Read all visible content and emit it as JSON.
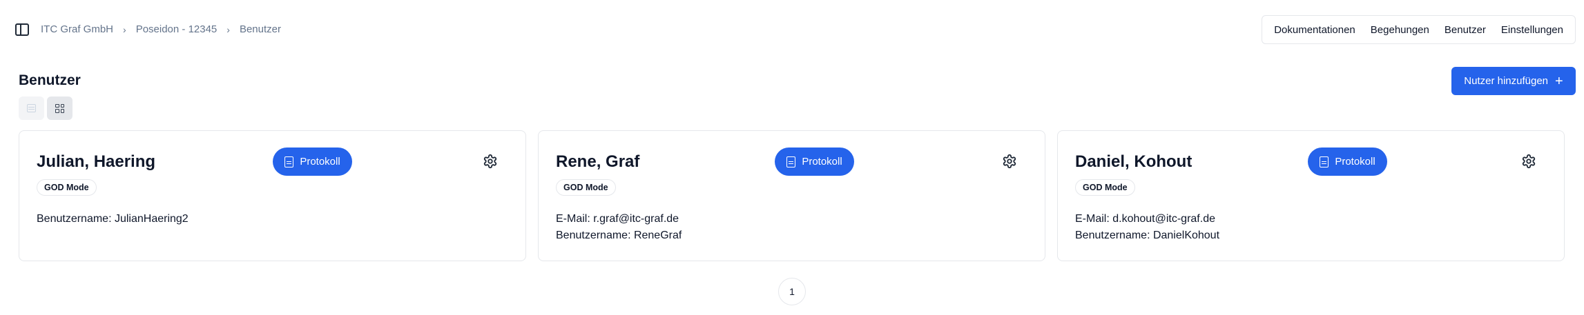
{
  "breadcrumb": [
    "ITC Graf GmbH",
    "Poseidon - 12345",
    "Benutzer"
  ],
  "nav": [
    "Dokumentationen",
    "Begehungen",
    "Benutzer",
    "Einstellungen"
  ],
  "page": {
    "title": "Benutzer",
    "add_button": "Nutzer hinzufügen"
  },
  "icons": {
    "sidebar": "sidebar-toggle-icon",
    "add": "plus-icon",
    "protokoll": "document-icon",
    "settings": "gear-icon",
    "view_list": "list-view-icon",
    "view_grid": "grid-view-icon"
  },
  "users": [
    {
      "name": "Julian, Haering",
      "protokoll_label": "Protokoll",
      "role": "GOD Mode",
      "lines": [
        "Benutzername: JulianHaering2"
      ]
    },
    {
      "name": "Rene, Graf",
      "protokoll_label": "Protokoll",
      "role": "GOD Mode",
      "lines": [
        "E-Mail: r.graf@itc-graf.de",
        "Benutzername: ReneGraf"
      ]
    },
    {
      "name": "Daniel, Kohout",
      "protokoll_label": "Protokoll",
      "role": "GOD Mode",
      "lines": [
        "E-Mail: d.kohout@itc-graf.de",
        "Benutzername: DanielKohout"
      ]
    }
  ],
  "pagination": {
    "current": "1"
  },
  "colors": {
    "primary": "#2563eb",
    "border": "#e5e7eb",
    "muted": "#64748b"
  }
}
